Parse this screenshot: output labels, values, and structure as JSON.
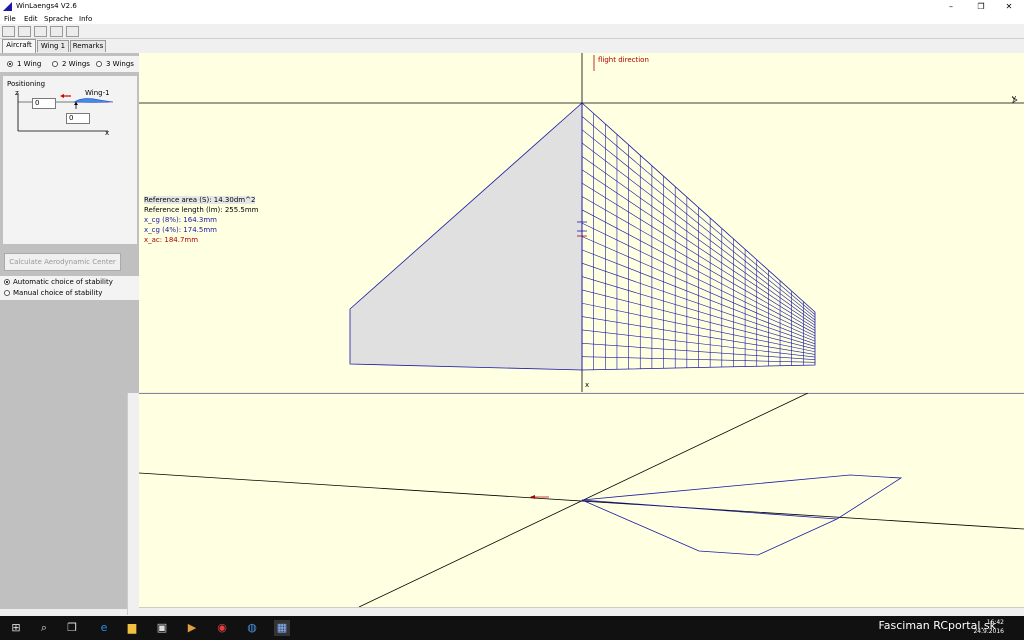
{
  "window": {
    "title": "WinLaengs4  V2.6"
  },
  "menu": [
    "File",
    "Edit",
    "Sprache",
    "Info"
  ],
  "tabs": [
    "Aircraft",
    "Wing 1",
    "Remarks"
  ],
  "wing_options": [
    "1 Wing",
    "2 Wings",
    "3 Wings"
  ],
  "positioning": {
    "label": "Positioning",
    "z_label": "z",
    "x_label": "x",
    "wing_label": "Wing-1",
    "z_value": "0",
    "x_value": "0"
  },
  "calc_button": "Calculate Aerodynamic Center",
  "stability": [
    "Automatic choice of stability",
    "Manual choice of stability"
  ],
  "top_view": {
    "flight_direction": "flight direction",
    "y_axis": "y",
    "x_axis": "x"
  },
  "info": {
    "ref_area": "Reference area (S): 14.30dm^2",
    "ref_length": "Reference length (lm): 255.5mm",
    "xcg8": "x_cg (8%): 164.3mm",
    "xcg4": "x_cg (4%): 174.5mm",
    "xac": "x_ac: 184.7mm"
  },
  "colors": {
    "view_bg": "#ffffe1",
    "wing_line": "#1a1aa6",
    "xcg_color": "#1a1aa6",
    "xac_color": "#b00000",
    "panel": "#c0c0c0"
  },
  "taskbar": {
    "time": "16:42",
    "date": "24.9.2016",
    "watermark": "Fasciman  RCportal.sk"
  }
}
